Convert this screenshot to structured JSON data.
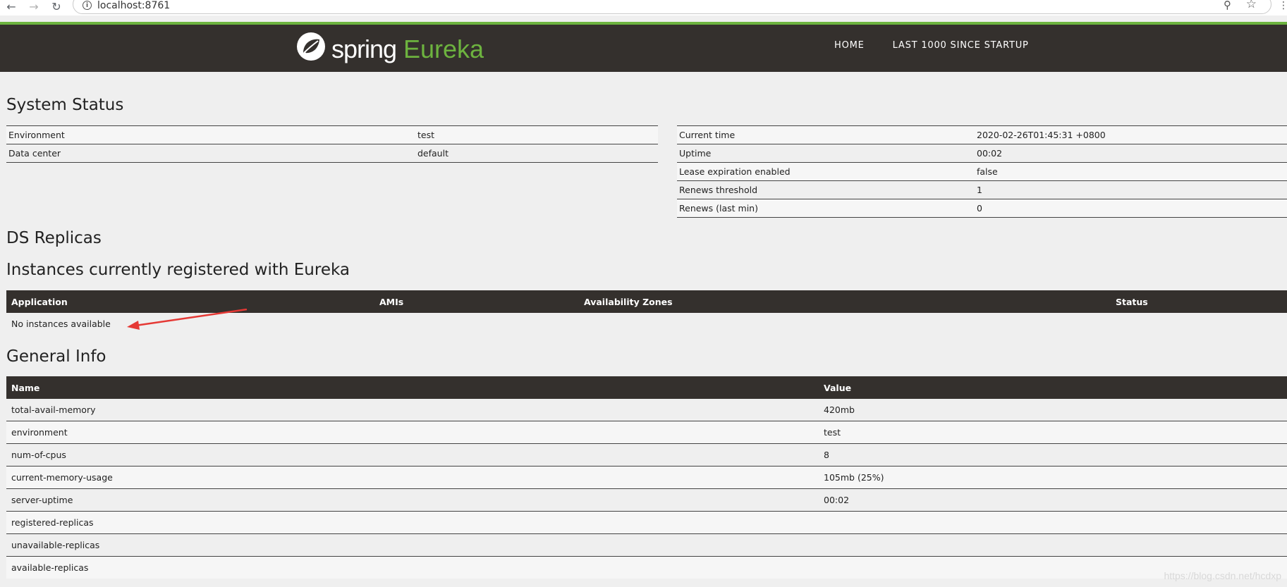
{
  "browser": {
    "url": "localhost:8761",
    "back_icon": "back-arrow-icon",
    "forward_icon": "forward-arrow-icon",
    "reload_icon": "reload-icon",
    "back_glyph": "←",
    "forward_glyph": "→",
    "reload_glyph": "↻",
    "zoom_glyph": "⚲",
    "star_glyph": "☆",
    "menu_glyph": "⋮"
  },
  "header": {
    "brand_word1": "spring",
    "brand_word2": "Eureka",
    "brand_accent_color": "#6db33f",
    "bar_color": "#34302d",
    "nav": {
      "home": "HOME",
      "last1000": "LAST 1000 SINCE STARTUP"
    }
  },
  "system_status": {
    "title": "System Status",
    "left": [
      {
        "label": "Environment",
        "value": "test"
      },
      {
        "label": "Data center",
        "value": "default"
      }
    ],
    "right": [
      {
        "label": "Current time",
        "value": "2020-02-26T01:45:31 +0800"
      },
      {
        "label": "Uptime",
        "value": "00:02"
      },
      {
        "label": "Lease expiration enabled",
        "value": "false"
      },
      {
        "label": "Renews threshold",
        "value": "1"
      },
      {
        "label": "Renews (last min)",
        "value": "0"
      }
    ]
  },
  "ds_replicas": {
    "title": "DS Replicas"
  },
  "instances": {
    "title": "Instances currently registered with Eureka",
    "columns": [
      "Application",
      "AMIs",
      "Availability Zones",
      "Status"
    ],
    "empty_text": "No instances available"
  },
  "general_info": {
    "title": "General Info",
    "columns": [
      "Name",
      "Value"
    ],
    "rows": [
      {
        "name": "total-avail-memory",
        "value": "420mb"
      },
      {
        "name": "environment",
        "value": "test"
      },
      {
        "name": "num-of-cpus",
        "value": "8"
      },
      {
        "name": "current-memory-usage",
        "value": "105mb (25%)"
      },
      {
        "name": "server-uptime",
        "value": "00:02"
      },
      {
        "name": "registered-replicas",
        "value": ""
      },
      {
        "name": "unavailable-replicas",
        "value": ""
      },
      {
        "name": "available-replicas",
        "value": ""
      }
    ]
  },
  "annotation": {
    "arrow_color": "#e53935"
  },
  "watermark": "https://blog.csdn.net/hcdxp"
}
